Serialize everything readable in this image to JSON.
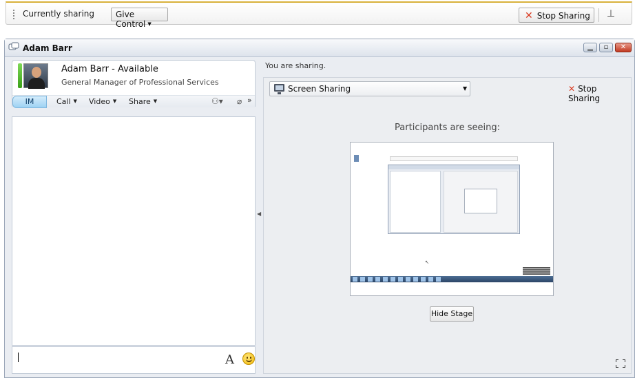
{
  "share_bar": {
    "status_text": "Currently sharing",
    "give_control_label": "Give Control",
    "stop_sharing_label": "Stop Sharing",
    "pin_icon": "pin-icon"
  },
  "window": {
    "title": "Adam Barr",
    "controls": [
      "minimize",
      "maximize",
      "close"
    ]
  },
  "contact": {
    "name_status": "Adam Barr - Available",
    "job_title": "General Manager of Professional Services",
    "presence_color": "#4cbb17"
  },
  "toolbar": {
    "im_label": "IM",
    "call_label": "Call",
    "video_label": "Video",
    "share_label": "Share",
    "more_label": "»"
  },
  "im_input": {
    "font_label": "A"
  },
  "sharing": {
    "status_text": "You are sharing.",
    "mode_selected": "Screen Sharing",
    "stop_sharing_label": "Stop Sharing",
    "participants_text": "Participants are seeing:",
    "hide_stage_label": "Hide Stage"
  },
  "colors": {
    "accent_gold": "#d8b13a",
    "stop_red": "#d9381e",
    "im_tab": "#9ed2f3"
  }
}
